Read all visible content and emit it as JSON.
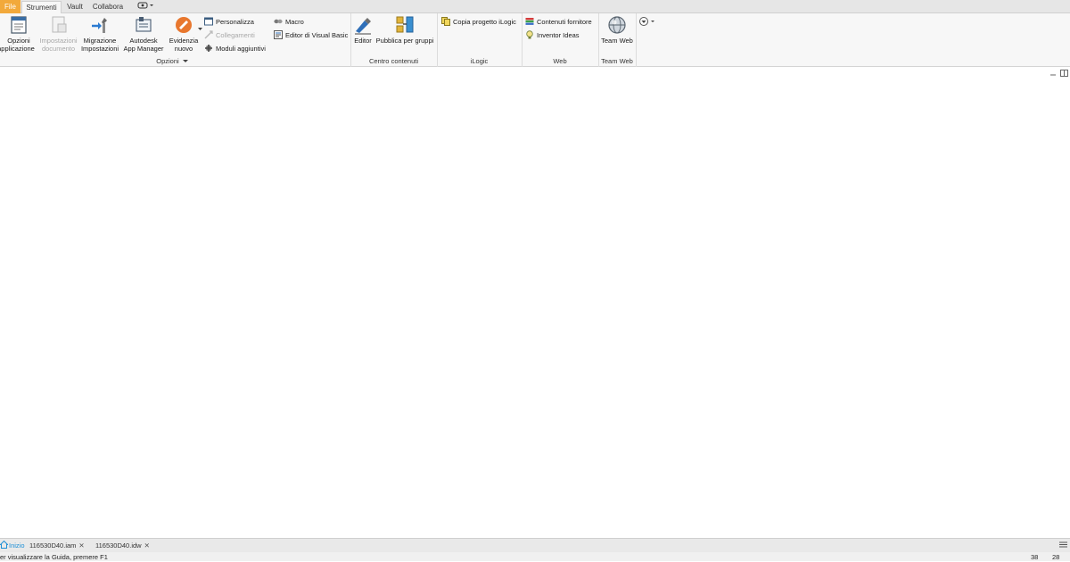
{
  "tabs": {
    "file": "File",
    "strumenti": "Strumenti",
    "vault": "Vault",
    "collabora": "Collabora",
    "extra_icon": "display-icon"
  },
  "opzioni": {
    "title": "Opzioni",
    "opzioni_applicazione": [
      "Opzioni",
      "applicazione"
    ],
    "impostazioni_documento": [
      "Impostazioni",
      "documento"
    ],
    "migrazione": [
      "Migrazione",
      "Impostazioni"
    ],
    "app_manager": [
      "Autodesk",
      "App Manager"
    ],
    "evidenzia": [
      "Evidenzia",
      "nuovo"
    ],
    "personalizza": "Personalizza",
    "collegamenti": "Collegamenti",
    "moduli": "Moduli aggiuntivi",
    "macro": "Macro",
    "editor_vb": "Editor di Visual Basic"
  },
  "centro_contenuti": {
    "title": "Centro contenuti",
    "editor": "Editor",
    "pubblica": "Pubblica per gruppi"
  },
  "ilogic": {
    "title": "iLogic",
    "copia": "Copia progetto iLogic"
  },
  "web": {
    "title": "Web",
    "contenuti": "Contenuti fornitore",
    "ideas": "Inventor Ideas"
  },
  "team_web": {
    "title": "Team Web",
    "button": "Team Web"
  },
  "doc_tabs": {
    "home": "Inizio",
    "tab1": "116530D40.iam",
    "tab2": "116530D40.idw"
  },
  "status": {
    "help": "er visualizzare la Guida, premere F1",
    "count1": "38",
    "count2": "28"
  },
  "colors": {
    "file_tab": "#f2a93b",
    "home_tab": "#1d8fd6"
  }
}
